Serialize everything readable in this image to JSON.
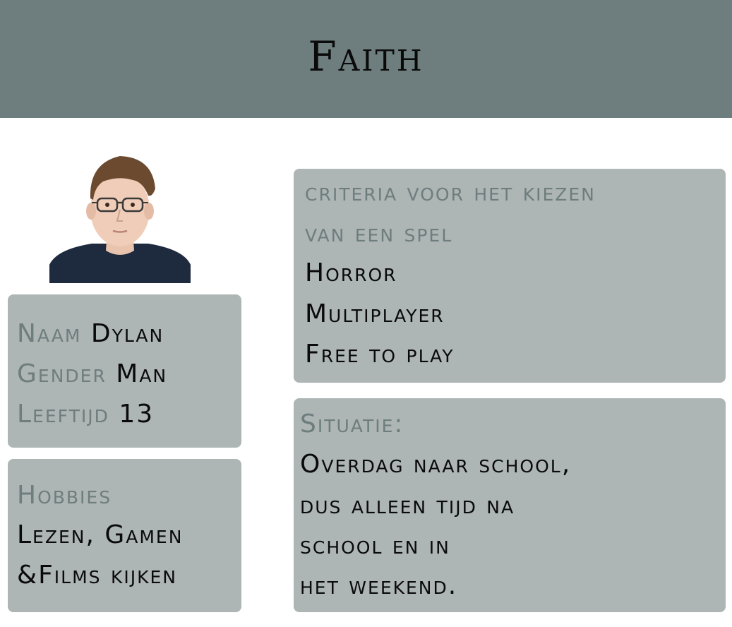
{
  "header": {
    "title": "Faith",
    "background_color": "#6e7d7d"
  },
  "profile": {
    "photo_icon": "person-portrait",
    "naam_label": "Naam",
    "naam_value": "Dylan",
    "gender_label": "Gender",
    "gender_value": "Man",
    "leeftijd_label": "Leeftijd",
    "leeftijd_value": "13"
  },
  "hobbies": {
    "label": "Hobbies",
    "lines": [
      "Lezen, Gamen",
      "&Films kijken"
    ]
  },
  "criteria": {
    "label_lines": [
      "criteria voor het kiezen",
      "van een spel"
    ],
    "items": [
      "Horror",
      "Multiplayer",
      "Free to play"
    ]
  },
  "situatie": {
    "label": "Situatie:",
    "lines": [
      "Overdag naar school,",
      "dus alleen tijd na",
      "school en in",
      "het weekend."
    ]
  },
  "colors": {
    "card_bg": "#aeb5b5",
    "label_color": "#6e7d7d",
    "text_color": "#0a0a0a"
  }
}
